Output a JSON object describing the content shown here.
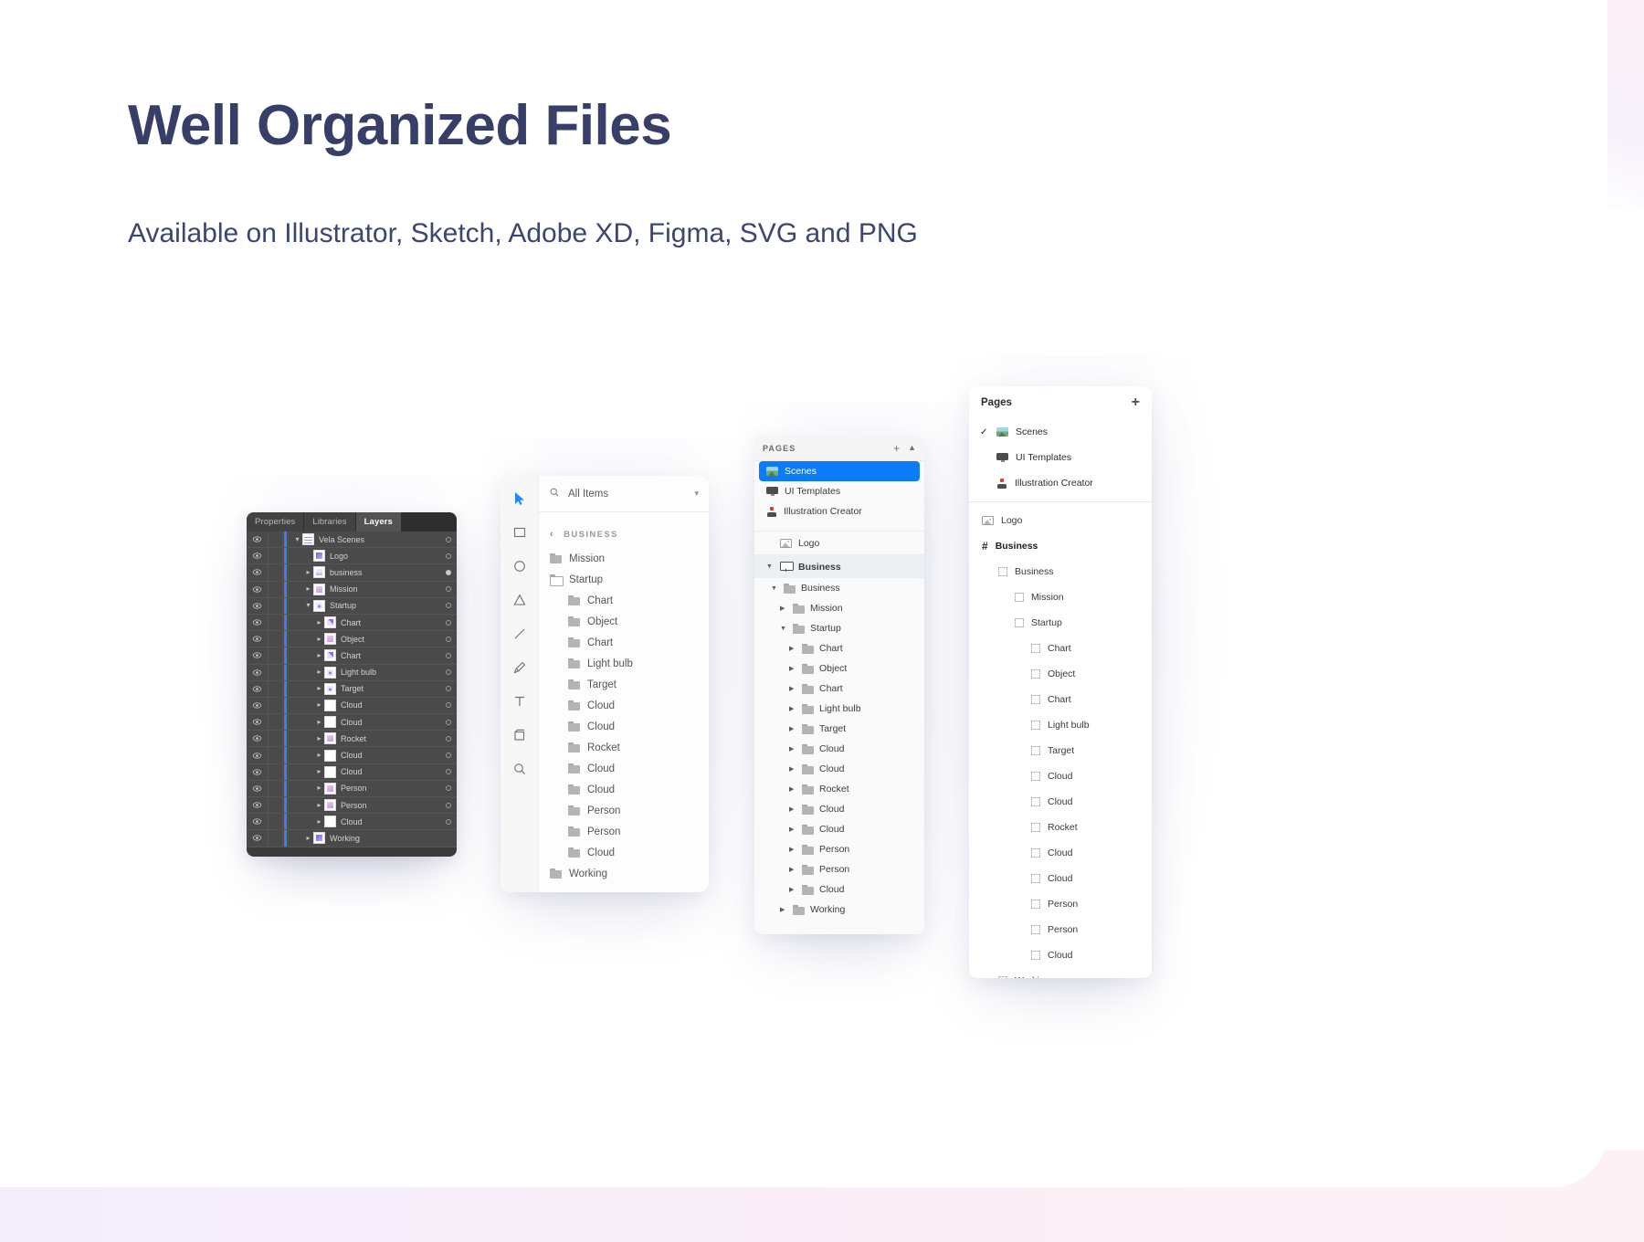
{
  "header": {
    "title": "Well Organized Files",
    "subtitle": "Available on Illustrator, Sketch, Adobe XD, Figma, SVG and PNG",
    "title_color": "#373f68",
    "accent_blue": "#0b7cf5"
  },
  "illustrator": {
    "tabs": [
      {
        "label": "Properties",
        "active": false
      },
      {
        "label": "Libraries",
        "active": false
      },
      {
        "label": "Layers",
        "active": true
      }
    ],
    "rows": [
      {
        "label": "Vela Scenes",
        "indent": 0,
        "arrow": "down",
        "thumb": "th-a",
        "dot": "hollow"
      },
      {
        "label": "Logo",
        "indent": 1,
        "arrow": "none",
        "thumb": "th-b",
        "dot": "hollow"
      },
      {
        "label": "business",
        "indent": 1,
        "arrow": "right",
        "thumb": "th-c",
        "dot": "filled"
      },
      {
        "label": "Mission",
        "indent": 1,
        "arrow": "right",
        "thumb": "th-pink",
        "dot": "hollow"
      },
      {
        "label": "Startup",
        "indent": 1,
        "arrow": "down",
        "thumb": "th-d",
        "dot": "hollow"
      },
      {
        "label": "Chart",
        "indent": 2,
        "arrow": "right",
        "thumb": "th-e",
        "dot": "hollow"
      },
      {
        "label": "Object",
        "indent": 2,
        "arrow": "right",
        "thumb": "th-pink",
        "dot": "hollow"
      },
      {
        "label": "Chart",
        "indent": 2,
        "arrow": "right",
        "thumb": "th-e",
        "dot": "hollow"
      },
      {
        "label": "Light bulb",
        "indent": 2,
        "arrow": "right",
        "thumb": "th-d",
        "dot": "hollow"
      },
      {
        "label": "Target",
        "indent": 2,
        "arrow": "right",
        "thumb": "th-d",
        "dot": "hollow"
      },
      {
        "label": "Cloud",
        "indent": 2,
        "arrow": "right",
        "thumb": "th-blank",
        "dot": "hollow"
      },
      {
        "label": "Cloud",
        "indent": 2,
        "arrow": "right",
        "thumb": "th-blank",
        "dot": "hollow"
      },
      {
        "label": "Rocket",
        "indent": 2,
        "arrow": "right",
        "thumb": "th-pink",
        "dot": "hollow"
      },
      {
        "label": "Cloud",
        "indent": 2,
        "arrow": "right",
        "thumb": "th-blank",
        "dot": "hollow"
      },
      {
        "label": "Cloud",
        "indent": 2,
        "arrow": "right",
        "thumb": "th-blank",
        "dot": "hollow"
      },
      {
        "label": "Person",
        "indent": 2,
        "arrow": "right",
        "thumb": "th-pink",
        "dot": "hollow"
      },
      {
        "label": "Person",
        "indent": 2,
        "arrow": "right",
        "thumb": "th-pink",
        "dot": "hollow"
      },
      {
        "label": "Cloud",
        "indent": 2,
        "arrow": "right",
        "thumb": "th-blank",
        "dot": "hollow"
      },
      {
        "label": "Working",
        "indent": 1,
        "arrow": "right",
        "thumb": "th-b",
        "dot": "none"
      }
    ]
  },
  "sketch": {
    "tools": [
      "cursor-icon",
      "rectangle-icon",
      "ellipse-icon",
      "triangle-icon",
      "line-icon",
      "pen-icon",
      "text-icon",
      "artboard-icon",
      "zoom-icon"
    ],
    "search_value": "All Items",
    "group_label": "BUSINESS",
    "rows": [
      {
        "label": "Mission",
        "indent": 1,
        "folder": "solid"
      },
      {
        "label": "Startup",
        "indent": 1,
        "folder": "open"
      },
      {
        "label": "Chart",
        "indent": 2,
        "folder": "solid"
      },
      {
        "label": "Object",
        "indent": 2,
        "folder": "solid"
      },
      {
        "label": "Chart",
        "indent": 2,
        "folder": "solid"
      },
      {
        "label": "Light bulb",
        "indent": 2,
        "folder": "solid"
      },
      {
        "label": "Target",
        "indent": 2,
        "folder": "solid"
      },
      {
        "label": "Cloud",
        "indent": 2,
        "folder": "solid"
      },
      {
        "label": "Cloud",
        "indent": 2,
        "folder": "solid"
      },
      {
        "label": "Rocket",
        "indent": 2,
        "folder": "solid"
      },
      {
        "label": "Cloud",
        "indent": 2,
        "folder": "solid"
      },
      {
        "label": "Cloud",
        "indent": 2,
        "folder": "solid"
      },
      {
        "label": "Person",
        "indent": 2,
        "folder": "solid"
      },
      {
        "label": "Person",
        "indent": 2,
        "folder": "solid"
      },
      {
        "label": "Cloud",
        "indent": 2,
        "folder": "solid"
      },
      {
        "label": "Working",
        "indent": 1,
        "folder": "solid"
      }
    ]
  },
  "xd": {
    "head_label": "PAGES",
    "add_icon": "plus-icon",
    "collapse_icon": "chevron-up-icon",
    "pages": [
      {
        "label": "Scenes",
        "icon": "scene-icon",
        "selected": true
      },
      {
        "label": "UI Templates",
        "icon": "monitor-icon",
        "selected": false
      },
      {
        "label": "Illustration Creator",
        "icon": "joystick-icon",
        "selected": false
      }
    ],
    "sections": [
      {
        "label": "Logo",
        "icon": "picture-icon",
        "highlight": false
      },
      {
        "label": "Business",
        "icon": "projector-icon",
        "highlight": true
      }
    ],
    "rows": [
      {
        "label": "Business",
        "indent": 1,
        "tri": "down"
      },
      {
        "label": "Mission",
        "indent": 2,
        "tri": "right"
      },
      {
        "label": "Startup",
        "indent": 2,
        "tri": "down"
      },
      {
        "label": "Chart",
        "indent": 3,
        "tri": "right"
      },
      {
        "label": "Object",
        "indent": 3,
        "tri": "right"
      },
      {
        "label": "Chart",
        "indent": 3,
        "tri": "right"
      },
      {
        "label": "Light bulb",
        "indent": 3,
        "tri": "right"
      },
      {
        "label": "Target",
        "indent": 3,
        "tri": "right"
      },
      {
        "label": "Cloud",
        "indent": 3,
        "tri": "right"
      },
      {
        "label": "Cloud",
        "indent": 3,
        "tri": "right"
      },
      {
        "label": "Rocket",
        "indent": 3,
        "tri": "right"
      },
      {
        "label": "Cloud",
        "indent": 3,
        "tri": "right"
      },
      {
        "label": "Cloud",
        "indent": 3,
        "tri": "right"
      },
      {
        "label": "Person",
        "indent": 3,
        "tri": "right"
      },
      {
        "label": "Person",
        "indent": 3,
        "tri": "right"
      },
      {
        "label": "Cloud",
        "indent": 3,
        "tri": "right"
      },
      {
        "label": "Working",
        "indent": 2,
        "tri": "right"
      }
    ]
  },
  "figma": {
    "head_label": "Pages",
    "add_icon": "plus-icon",
    "pages": [
      {
        "label": "Scenes",
        "icon": "scene-icon",
        "checked": true
      },
      {
        "label": "UI Templates",
        "icon": "monitor-icon",
        "checked": false
      },
      {
        "label": "Illustration Creator",
        "icon": "joystick-icon",
        "checked": false
      }
    ],
    "rows": [
      {
        "label": "Logo",
        "indent": 0,
        "icon": "picture-icon",
        "bold": false
      },
      {
        "label": "Business",
        "indent": 0,
        "icon": "hash-icon",
        "bold": true
      },
      {
        "label": "Business",
        "indent": 1,
        "icon": "frame-icon",
        "bold": false
      },
      {
        "label": "Mission",
        "indent": 2,
        "icon": "frame-icon",
        "bold": false
      },
      {
        "label": "Startup",
        "indent": 2,
        "icon": "frame-icon",
        "bold": false
      },
      {
        "label": "Chart",
        "indent": 3,
        "icon": "frame-icon",
        "bold": false
      },
      {
        "label": "Object",
        "indent": 3,
        "icon": "frame-icon",
        "bold": false
      },
      {
        "label": "Chart",
        "indent": 3,
        "icon": "frame-icon",
        "bold": false
      },
      {
        "label": "Light bulb",
        "indent": 3,
        "icon": "frame-icon",
        "bold": false
      },
      {
        "label": "Target",
        "indent": 3,
        "icon": "frame-icon",
        "bold": false
      },
      {
        "label": "Cloud",
        "indent": 3,
        "icon": "frame-icon",
        "bold": false
      },
      {
        "label": "Cloud",
        "indent": 3,
        "icon": "frame-icon",
        "bold": false
      },
      {
        "label": "Rocket",
        "indent": 3,
        "icon": "frame-icon",
        "bold": false
      },
      {
        "label": "Cloud",
        "indent": 3,
        "icon": "frame-icon",
        "bold": false
      },
      {
        "label": "Cloud",
        "indent": 3,
        "icon": "frame-icon",
        "bold": false
      },
      {
        "label": "Person",
        "indent": 3,
        "icon": "frame-icon",
        "bold": false
      },
      {
        "label": "Person",
        "indent": 3,
        "icon": "frame-icon",
        "bold": false
      },
      {
        "label": "Cloud",
        "indent": 3,
        "icon": "frame-icon",
        "bold": false
      },
      {
        "label": "Working",
        "indent": 1,
        "icon": "frame-icon",
        "bold": false
      }
    ]
  }
}
